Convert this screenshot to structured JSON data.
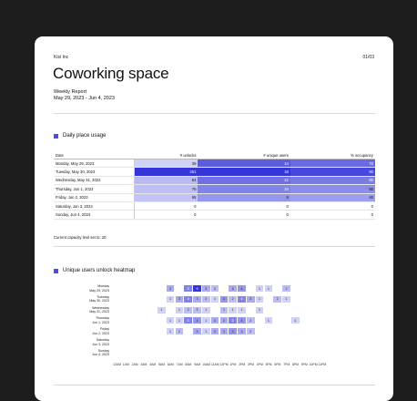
{
  "header": {
    "company": "Kisi Inc",
    "page": "01/03",
    "title": "Coworking space",
    "report_label": "Weekly Report",
    "date_range": "May 29, 2023 - Jun 4, 2023"
  },
  "usage": {
    "section_title": "Daily place usage",
    "columns": [
      "Date",
      "# unlocks",
      "# unique users",
      "% occupancy"
    ],
    "rows": [
      {
        "date": "Monday, May 29, 2023",
        "unlocks": "39",
        "users": "14",
        "occupancy": "70"
      },
      {
        "date": "Tuesday, May 30, 2023",
        "unlocks": "351",
        "users": "18",
        "occupancy": "90"
      },
      {
        "date": "Wednesday, May 31, 2022",
        "unlocks": "84",
        "users": "12",
        "occupancy": "60"
      },
      {
        "date": "Thursday, Jun 1, 2023",
        "unlocks": "75",
        "users": "10",
        "occupancy": "50"
      },
      {
        "date": "Friday, Jun 2, 2023",
        "unlocks": "65",
        "users": "8",
        "occupancy": "40"
      },
      {
        "date": "Saturday, Jun 3, 2023",
        "unlocks": "0",
        "users": "0",
        "occupancy": "0"
      },
      {
        "date": "Sunday, Jun 4, 2023",
        "unlocks": "0",
        "users": "0",
        "occupancy": "0"
      }
    ],
    "note": "Current capacity limit set to: 20"
  },
  "heatmap": {
    "section_title": "Unique users unlock heatmap",
    "days": [
      {
        "day": "Monday",
        "date": "May 29, 2023"
      },
      {
        "day": "Tuesday",
        "date": "May 30, 2023"
      },
      {
        "day": "Wednesday",
        "date": "May 31, 2023"
      },
      {
        "day": "Thursday",
        "date": "Jun 1, 2023"
      },
      {
        "day": "Friday",
        "date": "Jun 2, 2023"
      },
      {
        "day": "Saturday",
        "date": "Jun 3, 2023"
      },
      {
        "day": "Sunday",
        "date": "Jun 4, 2023"
      }
    ],
    "hours": [
      "12AM",
      "1AM",
      "2AM",
      "3AM",
      "4AM",
      "5AM",
      "6AM",
      "7AM",
      "8AM",
      "9AM",
      "10AM",
      "11AM",
      "12PM",
      "1PM",
      "2PM",
      "3PM",
      "4PM",
      "5PM",
      "6PM",
      "7PM",
      "8PM",
      "9PM",
      "10PM",
      "11PM"
    ],
    "values": [
      [
        0,
        0,
        0,
        0,
        0,
        0,
        3,
        0,
        5,
        9,
        3,
        2,
        0,
        3,
        4,
        0,
        1,
        1,
        0,
        2,
        0,
        0,
        0,
        0
      ],
      [
        0,
        0,
        0,
        0,
        0,
        0,
        1,
        3,
        5,
        3,
        2,
        1,
        4,
        2,
        5,
        3,
        1,
        0,
        2,
        1,
        0,
        0,
        0,
        0
      ],
      [
        0,
        0,
        0,
        0,
        0,
        1,
        0,
        1,
        2,
        2,
        1,
        0,
        2,
        1,
        1,
        0,
        1,
        0,
        0,
        0,
        0,
        0,
        0,
        0
      ],
      [
        0,
        0,
        0,
        0,
        0,
        0,
        1,
        1,
        5,
        4,
        1,
        3,
        3,
        5,
        4,
        2,
        0,
        1,
        0,
        0,
        1,
        0,
        0,
        0
      ],
      [
        0,
        0,
        0,
        0,
        0,
        0,
        1,
        2,
        0,
        3,
        1,
        3,
        3,
        4,
        3,
        2,
        0,
        0,
        0,
        0,
        0,
        0,
        0,
        0
      ],
      [
        0,
        0,
        0,
        0,
        0,
        0,
        0,
        0,
        0,
        0,
        0,
        0,
        0,
        0,
        0,
        0,
        0,
        0,
        0,
        0,
        0,
        0,
        0,
        0
      ],
      [
        0,
        0,
        0,
        0,
        0,
        0,
        0,
        0,
        0,
        0,
        0,
        0,
        0,
        0,
        0,
        0,
        0,
        0,
        0,
        0,
        0,
        0,
        0,
        0
      ]
    ],
    "colors": {
      "low": "#e3e4fb",
      "high": "#3436d8"
    }
  }
}
